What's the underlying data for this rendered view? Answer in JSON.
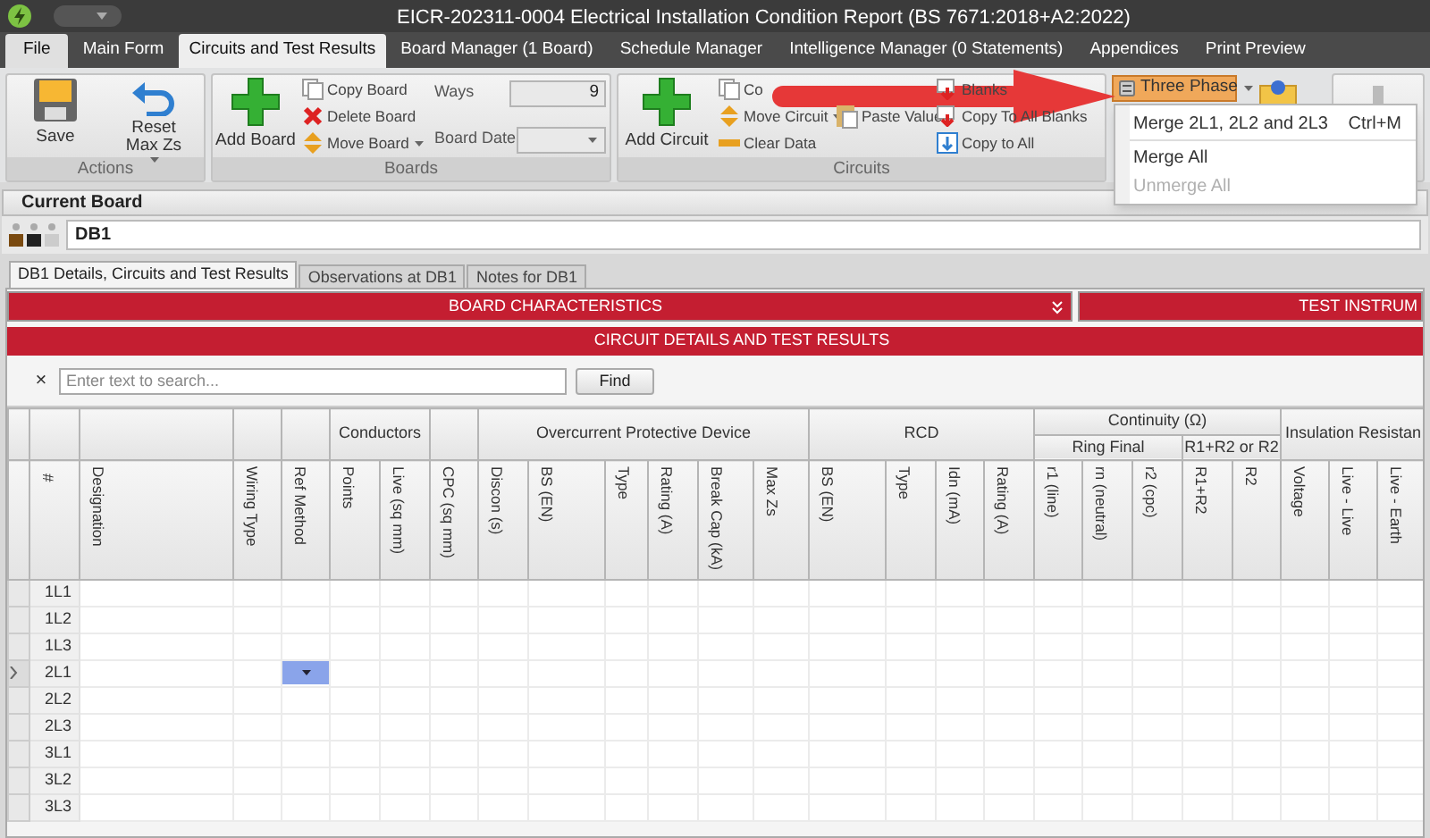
{
  "window": {
    "title": "EICR-202311-0004 Electrical Installation Condition Report (BS 7671:2018+A2:2022)"
  },
  "ribbon_tabs": [
    {
      "label": "File",
      "selected": false,
      "kind": "file"
    },
    {
      "label": "Main Form",
      "selected": false,
      "kind": "tab"
    },
    {
      "label": "Circuits and Test Results",
      "selected": true,
      "kind": "tab"
    },
    {
      "label": "Board Manager (1 Board)",
      "selected": false,
      "kind": "tab"
    },
    {
      "label": "Schedule Manager",
      "selected": false,
      "kind": "tab"
    },
    {
      "label": "Intelligence Manager (0 Statements)",
      "selected": false,
      "kind": "tab"
    },
    {
      "label": "Appendices",
      "selected": false,
      "kind": "tab"
    },
    {
      "label": "Print Preview",
      "selected": false,
      "kind": "tab"
    }
  ],
  "ribbon_groups": [
    {
      "label": "Actions",
      "columns": [
        [
          {
            "kind": "save",
            "label": "Save",
            "large": true
          }
        ],
        [
          {
            "kind": "undo",
            "label": "Reset Max Zs",
            "large": true,
            "caret": true
          }
        ]
      ]
    },
    {
      "label": "Boards",
      "columns": [
        [
          {
            "kind": "add",
            "label": "Add Board",
            "large": true
          }
        ],
        [
          {
            "kind": "copy",
            "label": "Copy Board"
          },
          {
            "kind": "delete",
            "label": "Delete Board"
          },
          {
            "kind": "move",
            "label": "Move Board",
            "caret": true
          }
        ],
        [
          {
            "kind": "field",
            "label": "Ways",
            "value": "9"
          },
          {
            "kind": "date",
            "label": "Board Date"
          }
        ]
      ]
    },
    {
      "label": "Circuits",
      "columns": [
        [
          {
            "kind": "add",
            "label": "Add Circuit",
            "large": true
          }
        ],
        [
          {
            "kind": "copy",
            "label": "Co"
          },
          {
            "kind": "move",
            "label": "Move Circuit",
            "caret": true
          },
          {
            "kind": "clear",
            "label": "Clear Data"
          }
        ],
        [
          {
            "kind": "paste",
            "label": "Paste Value"
          }
        ],
        [
          {
            "kind": "copydown",
            "label": "Blanks"
          },
          {
            "kind": "copydown",
            "label": "Copy To All Blanks"
          },
          {
            "kind": "copyall",
            "label": "Copy to All"
          }
        ]
      ]
    }
  ],
  "three_phase": {
    "label": "Three Phase",
    "selected": true,
    "menu": [
      {
        "label": "Merge 2L1, 2L2 and 2L3",
        "shortcut": "Ctrl+M",
        "disabled": false
      },
      {
        "label": "Merge All",
        "disabled": false
      },
      {
        "label": "Unmerge All",
        "disabled": true
      }
    ]
  },
  "current_board": {
    "heading": "Current Board",
    "value": "DB1"
  },
  "board_tabs": [
    {
      "label": "DB1 Details, Circuits and Test Results",
      "selected": true
    },
    {
      "label": "Observations at DB1",
      "selected": false
    },
    {
      "label": "Notes for DB1",
      "selected": false
    }
  ],
  "sections": {
    "board": "BOARD CHARACTERISTICS",
    "test": "TEST INSTRUM",
    "circuits": "CIRCUIT DETAILS AND TEST RESULTS"
  },
  "search": {
    "clear": "×",
    "placeholder": "Enter text to search...",
    "button": "Find"
  },
  "groups": [
    {
      "label": "Conductors"
    },
    {
      "label": "Overcurrent Protective Device"
    },
    {
      "label": "RCD"
    },
    {
      "label": "Continuity (Ω)",
      "children": [
        {
          "label": "Ring Final"
        },
        {
          "label": "R1+R2 or R2"
        }
      ]
    },
    {
      "label": "Insulation Resistan"
    }
  ],
  "columns": [
    "#",
    "Designation",
    "Wiring Type",
    "Ref Method",
    "Points",
    "Live (sq mm)",
    "CPC (sq mm)",
    "Discon (s)",
    "BS (EN)",
    "Type",
    "Rating (A)",
    "Break Cap (kA)",
    "Max Zs",
    "BS (EN)",
    "Type",
    "Idn (mA)",
    "Rating (A)",
    "r1 (line)",
    "rn (neutral)",
    "r2 (cpc)",
    "R1+R2",
    "R2",
    "Voltage",
    "Live - Live",
    "Live - Earth"
  ],
  "rows": [
    {
      "number": "1L1",
      "selected": false
    },
    {
      "number": "1L2",
      "selected": false
    },
    {
      "number": "1L3",
      "selected": false
    },
    {
      "number": "2L1",
      "selected": true
    },
    {
      "number": "2L2",
      "selected": false
    },
    {
      "number": "2L3",
      "selected": false
    },
    {
      "number": "3L1",
      "selected": false
    },
    {
      "number": "3L2",
      "selected": false
    },
    {
      "number": "3L3",
      "selected": false
    }
  ]
}
